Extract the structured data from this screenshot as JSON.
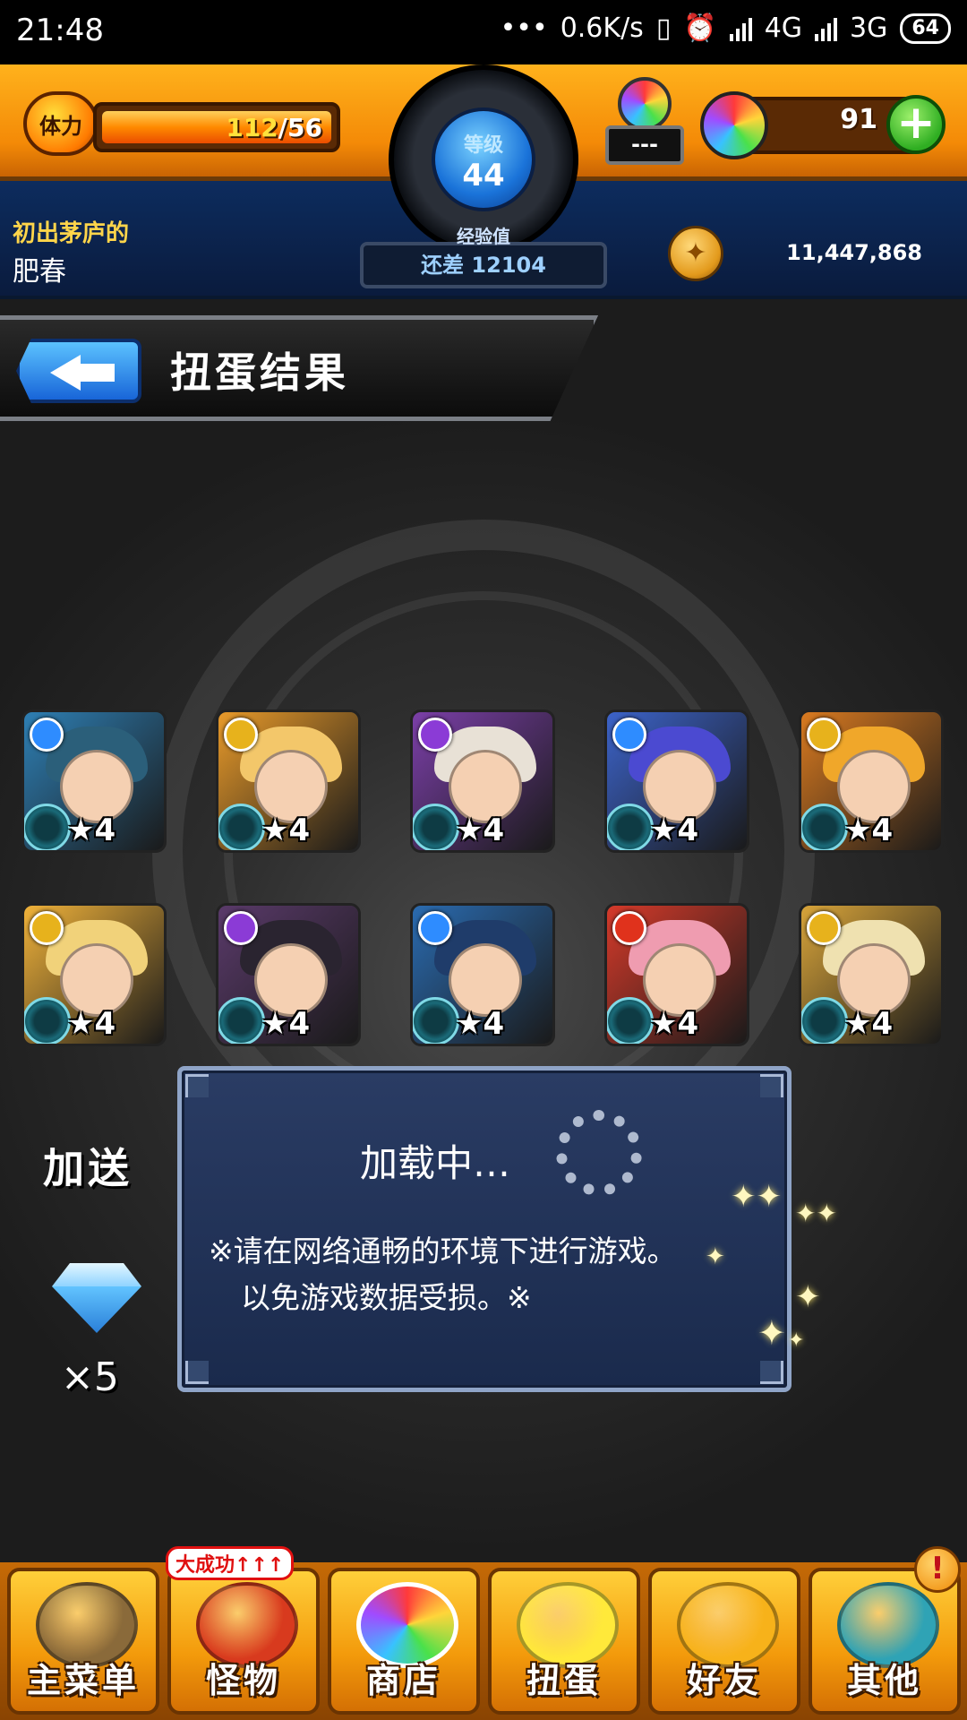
{
  "status_bar": {
    "time": "21:48",
    "network_speed": "0.6K/s",
    "network_1": "4G",
    "network_2": "3G",
    "battery": "64"
  },
  "hud": {
    "stamina_label": "体力",
    "stamina_current": "112",
    "stamina_max": "/56",
    "level_label": "等级",
    "level_value": "44",
    "exp_label": "经验值",
    "exp_remaining": "还差 12104",
    "orb_slot_text": "---",
    "gem_count": "91",
    "player_title": "初出茅庐的",
    "player_name": "肥春",
    "coin_count": "11,447,868",
    "colors": {
      "orange": "#f48a07",
      "blue_panel": "#0d2c5e",
      "level_blue": "#1a73d9"
    }
  },
  "title_bar": {
    "title": "扭蛋结果"
  },
  "monsters": [
    {
      "stars": "★4",
      "element": "water",
      "elem_color": "#2e8cff",
      "bg": "#2e7fb4",
      "hair": "#2b5f7a"
    },
    {
      "stars": "★4",
      "element": "light",
      "elem_color": "#e7b21c",
      "bg": "#e89a2a",
      "hair": "#f3c76a"
    },
    {
      "stars": "★4",
      "element": "dark",
      "elem_color": "#8b3bd6",
      "bg": "#7b3fa8",
      "hair": "#e8e1d6"
    },
    {
      "stars": "★4",
      "element": "water",
      "elem_color": "#2e8cff",
      "bg": "#3c63c9",
      "hair": "#4b4ad1"
    },
    {
      "stars": "★4",
      "element": "light",
      "elem_color": "#e7b21c",
      "bg": "#d97a20",
      "hair": "#f0a72a"
    },
    {
      "stars": "★4",
      "element": "light",
      "elem_color": "#e7b21c",
      "bg": "#f0b23a",
      "hair": "#f1d27a"
    },
    {
      "stars": "★4",
      "element": "dark",
      "elem_color": "#8b3bd6",
      "bg": "#5a3a6a",
      "hair": "#2a2430"
    },
    {
      "stars": "★4",
      "element": "water",
      "elem_color": "#2e8cff",
      "bg": "#2a6bb0",
      "hair": "#1f3c6a"
    },
    {
      "stars": "★4",
      "element": "fire",
      "elem_color": "#e0321c",
      "bg": "#d53a2a",
      "hair": "#ef9cb0"
    },
    {
      "stars": "★4",
      "element": "light",
      "elem_color": "#e7b21c",
      "bg": "#d8a43a",
      "hair": "#efe1b0"
    }
  ],
  "bonus": {
    "label": "加送",
    "count": "×5"
  },
  "loading_dialog": {
    "title": "加载中…",
    "note_line1": "※请在网络通畅的环境下进行游戏。",
    "note_line2": "以免游戏数据受损。※"
  },
  "bottom_nav": {
    "items": [
      {
        "label": "主菜单",
        "icon": "gate-icon",
        "color": "#8a6a3a"
      },
      {
        "label": "怪物",
        "icon": "monster-icon",
        "color": "#d83a1e",
        "badge": "大成功↑↑↑"
      },
      {
        "label": "商店",
        "icon": "orb-icon",
        "color": "#ffffff"
      },
      {
        "label": "扭蛋",
        "icon": "egg-icon",
        "color": "#ffe93a"
      },
      {
        "label": "好友",
        "icon": "friends-icon",
        "color": "#f7b21a"
      },
      {
        "label": "其他",
        "icon": "settings-icon",
        "color": "#2fa3b5",
        "alert": "!"
      }
    ]
  }
}
